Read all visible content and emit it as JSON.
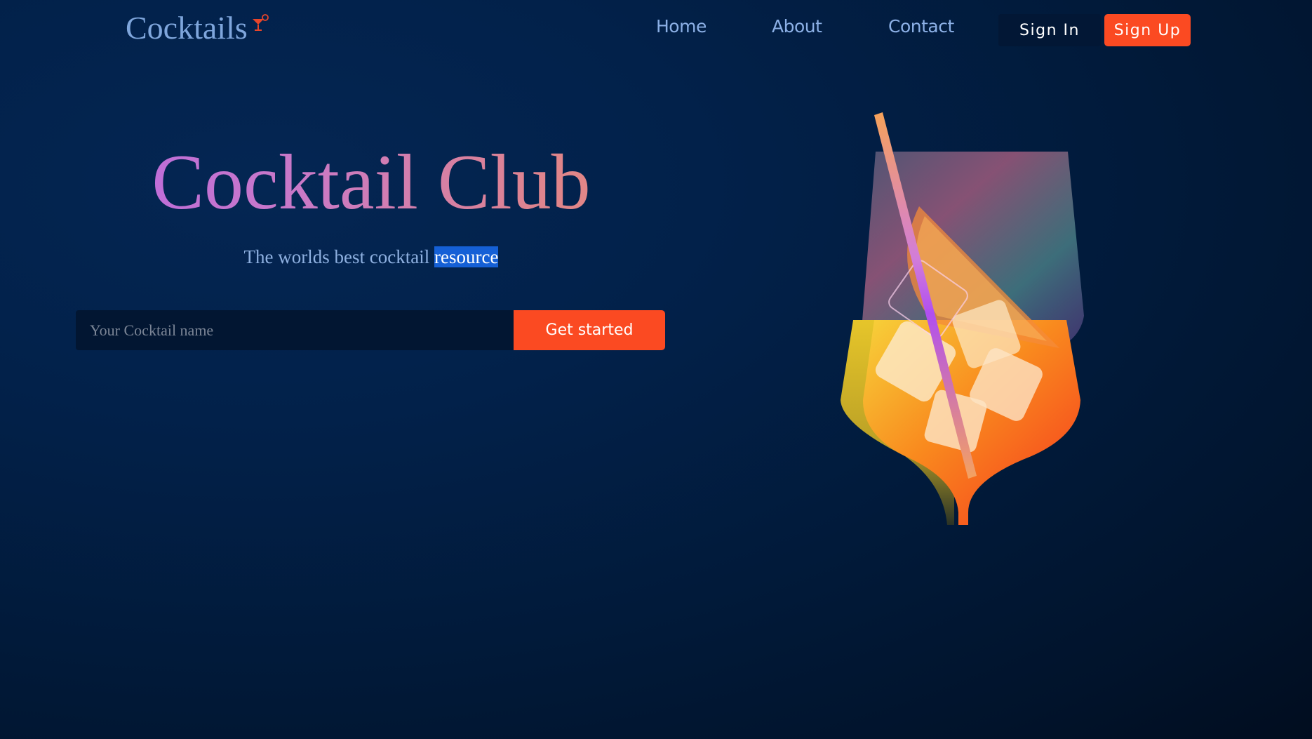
{
  "header": {
    "logo_text": "Cocktails",
    "logo_icon": "martini-glass-icon",
    "nav": [
      {
        "label": "Home"
      },
      {
        "label": "About"
      },
      {
        "label": "Contact"
      }
    ],
    "sign_in_label": "Sign In",
    "sign_up_label": "Sign Up"
  },
  "hero": {
    "title": "Cocktail Club",
    "subtitle_prefix": "The worlds best cocktail ",
    "subtitle_selected": "resource",
    "search_placeholder": "Your Cocktail name",
    "search_value": "",
    "cta_label": "Get started",
    "illustration": "cocktail-glass-illustration"
  },
  "colors": {
    "background": "#011c3d",
    "accent": "#fb4a22",
    "nav_text": "#8cb0e6",
    "selection": "#1560d6"
  }
}
